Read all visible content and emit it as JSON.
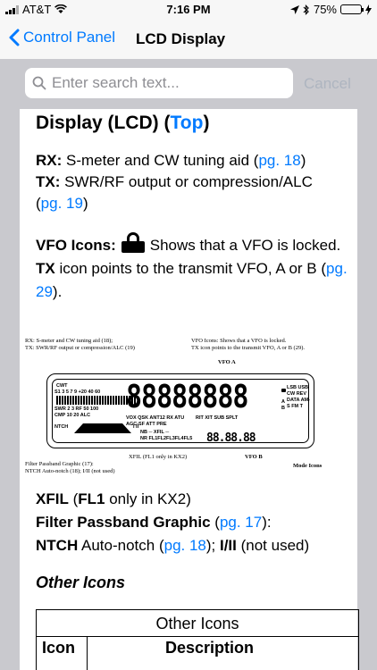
{
  "status": {
    "carrier": "AT&T",
    "time": "7:16 PM",
    "battery_pct": "75%",
    "battery_level": 0.75
  },
  "nav": {
    "back_label": "Control Panel",
    "title": "LCD Display"
  },
  "search": {
    "placeholder": "Enter search text...",
    "cancel_label": "Cancel"
  },
  "doc": {
    "heading": "Display (LCD) (",
    "heading_link": "Top",
    "heading_end": ")",
    "rx_label": "RX:",
    "rx_text": " S-meter and CW tuning aid (",
    "rx_link": "pg. 18",
    "rx_end": ")",
    "tx_label": "TX:",
    "tx_text": " SWR/RF output or compression/ALC",
    "tx_open": "(",
    "tx_link": "pg. 19",
    "tx_end": ")",
    "vfo_label": "VFO Icons:",
    "vfo_text": "Shows that a VFO is locked.",
    "tx_icon_label": "TX",
    "tx_icon_text": " icon points to the transmit VFO, A or B (",
    "tx_icon_link": "pg. 29",
    "tx_icon_end": ").",
    "xfil_label": "XFIL",
    "xfil_open": " (",
    "xfil_bold": "FL1",
    "xfil_text": " only in KX2)",
    "fpg_label": "Filter Passband Graphic",
    "fpg_open": " (",
    "fpg_link": "pg. 17",
    "fpg_end": "):",
    "ntch_label": "NTCH",
    "ntch_text": " Auto-notch (",
    "ntch_link": "pg. 18",
    "ntch_mid": "); ",
    "ntch_bold": "I/II",
    "ntch_end": " (not used)",
    "other_icons_heading": "Other Icons",
    "table_caption": "Other Icons",
    "table_col_icon": "Icon",
    "table_col_desc": "Description"
  },
  "figure": {
    "rx_note": "RX: S-meter and CW tuning aid (18);",
    "tx_note": "TX: SWR/RF output or compression/ALC (19)",
    "vfo_note": "VFO Icons: Shows that a VFO is locked.",
    "tx_icon_note": "TX icon points to the transmit VFO, A or B (29).",
    "vfo_a": "VFO A",
    "vfo_b": "VFO B",
    "xfil_note": "XFIL (FL1 only in KX2)",
    "fpg_note": "Filter Passband Graphic (17):",
    "ntch_note": "NTCH Auto-notch (18); I/II (not used)",
    "mode_icons": "Mode Icons",
    "lcd_digits": "88888888",
    "lcd_digits_small": "88.88.88",
    "scale": "S1 3 5 7 9 +20 40 60",
    "cwt": "CWT",
    "swr_scale": "SWR 2 3 RF 50 100",
    "cmp_scale": "CMP 10 20 ALC",
    "ntch": "NTCH",
    "i_ii": "I  II",
    "row1_icons": "VOX QSK ANT12 RX ATU",
    "row1_boxes": "RIT XIT SUB SPLT",
    "row2_icons": "AGC-SF ATT PRE",
    "nb_nr": "NB ─ XFIL ─",
    "nr_fl": "NR FL1FL2FL3FL4FL5",
    "modes": "LSB USB CW REV DATA AM-S FM T",
    "mode_letters": "A B"
  }
}
